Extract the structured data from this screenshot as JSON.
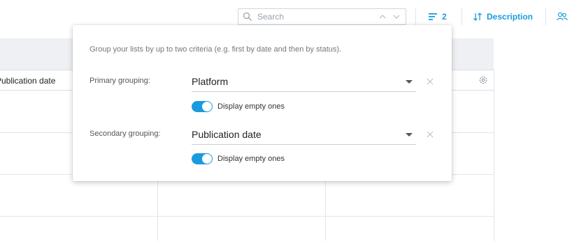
{
  "toolbar": {
    "search": {
      "placeholder": "Search"
    },
    "grouping_count": "2",
    "sort_label": "Description",
    "colors": {
      "accent": "#1a9bde"
    },
    "icons": [
      "search-icon",
      "chevron-up-icon",
      "chevron-down-icon",
      "group-lines-icon",
      "sort-arrows-icon",
      "people-icon"
    ]
  },
  "table": {
    "columns": [
      {
        "label": "Publication date"
      }
    ],
    "icons": [
      "settings-gear-icon"
    ]
  },
  "grouping_popover": {
    "description": "Group your lists by up to two criteria (e.g. first by date and then by status).",
    "primary": {
      "label": "Primary grouping:",
      "value": "Platform",
      "display_empty_label": "Display empty ones",
      "display_empty_on": true
    },
    "secondary": {
      "label": "Secondary grouping:",
      "value": "Publication date",
      "display_empty_label": "Display empty ones",
      "display_empty_on": true
    }
  }
}
